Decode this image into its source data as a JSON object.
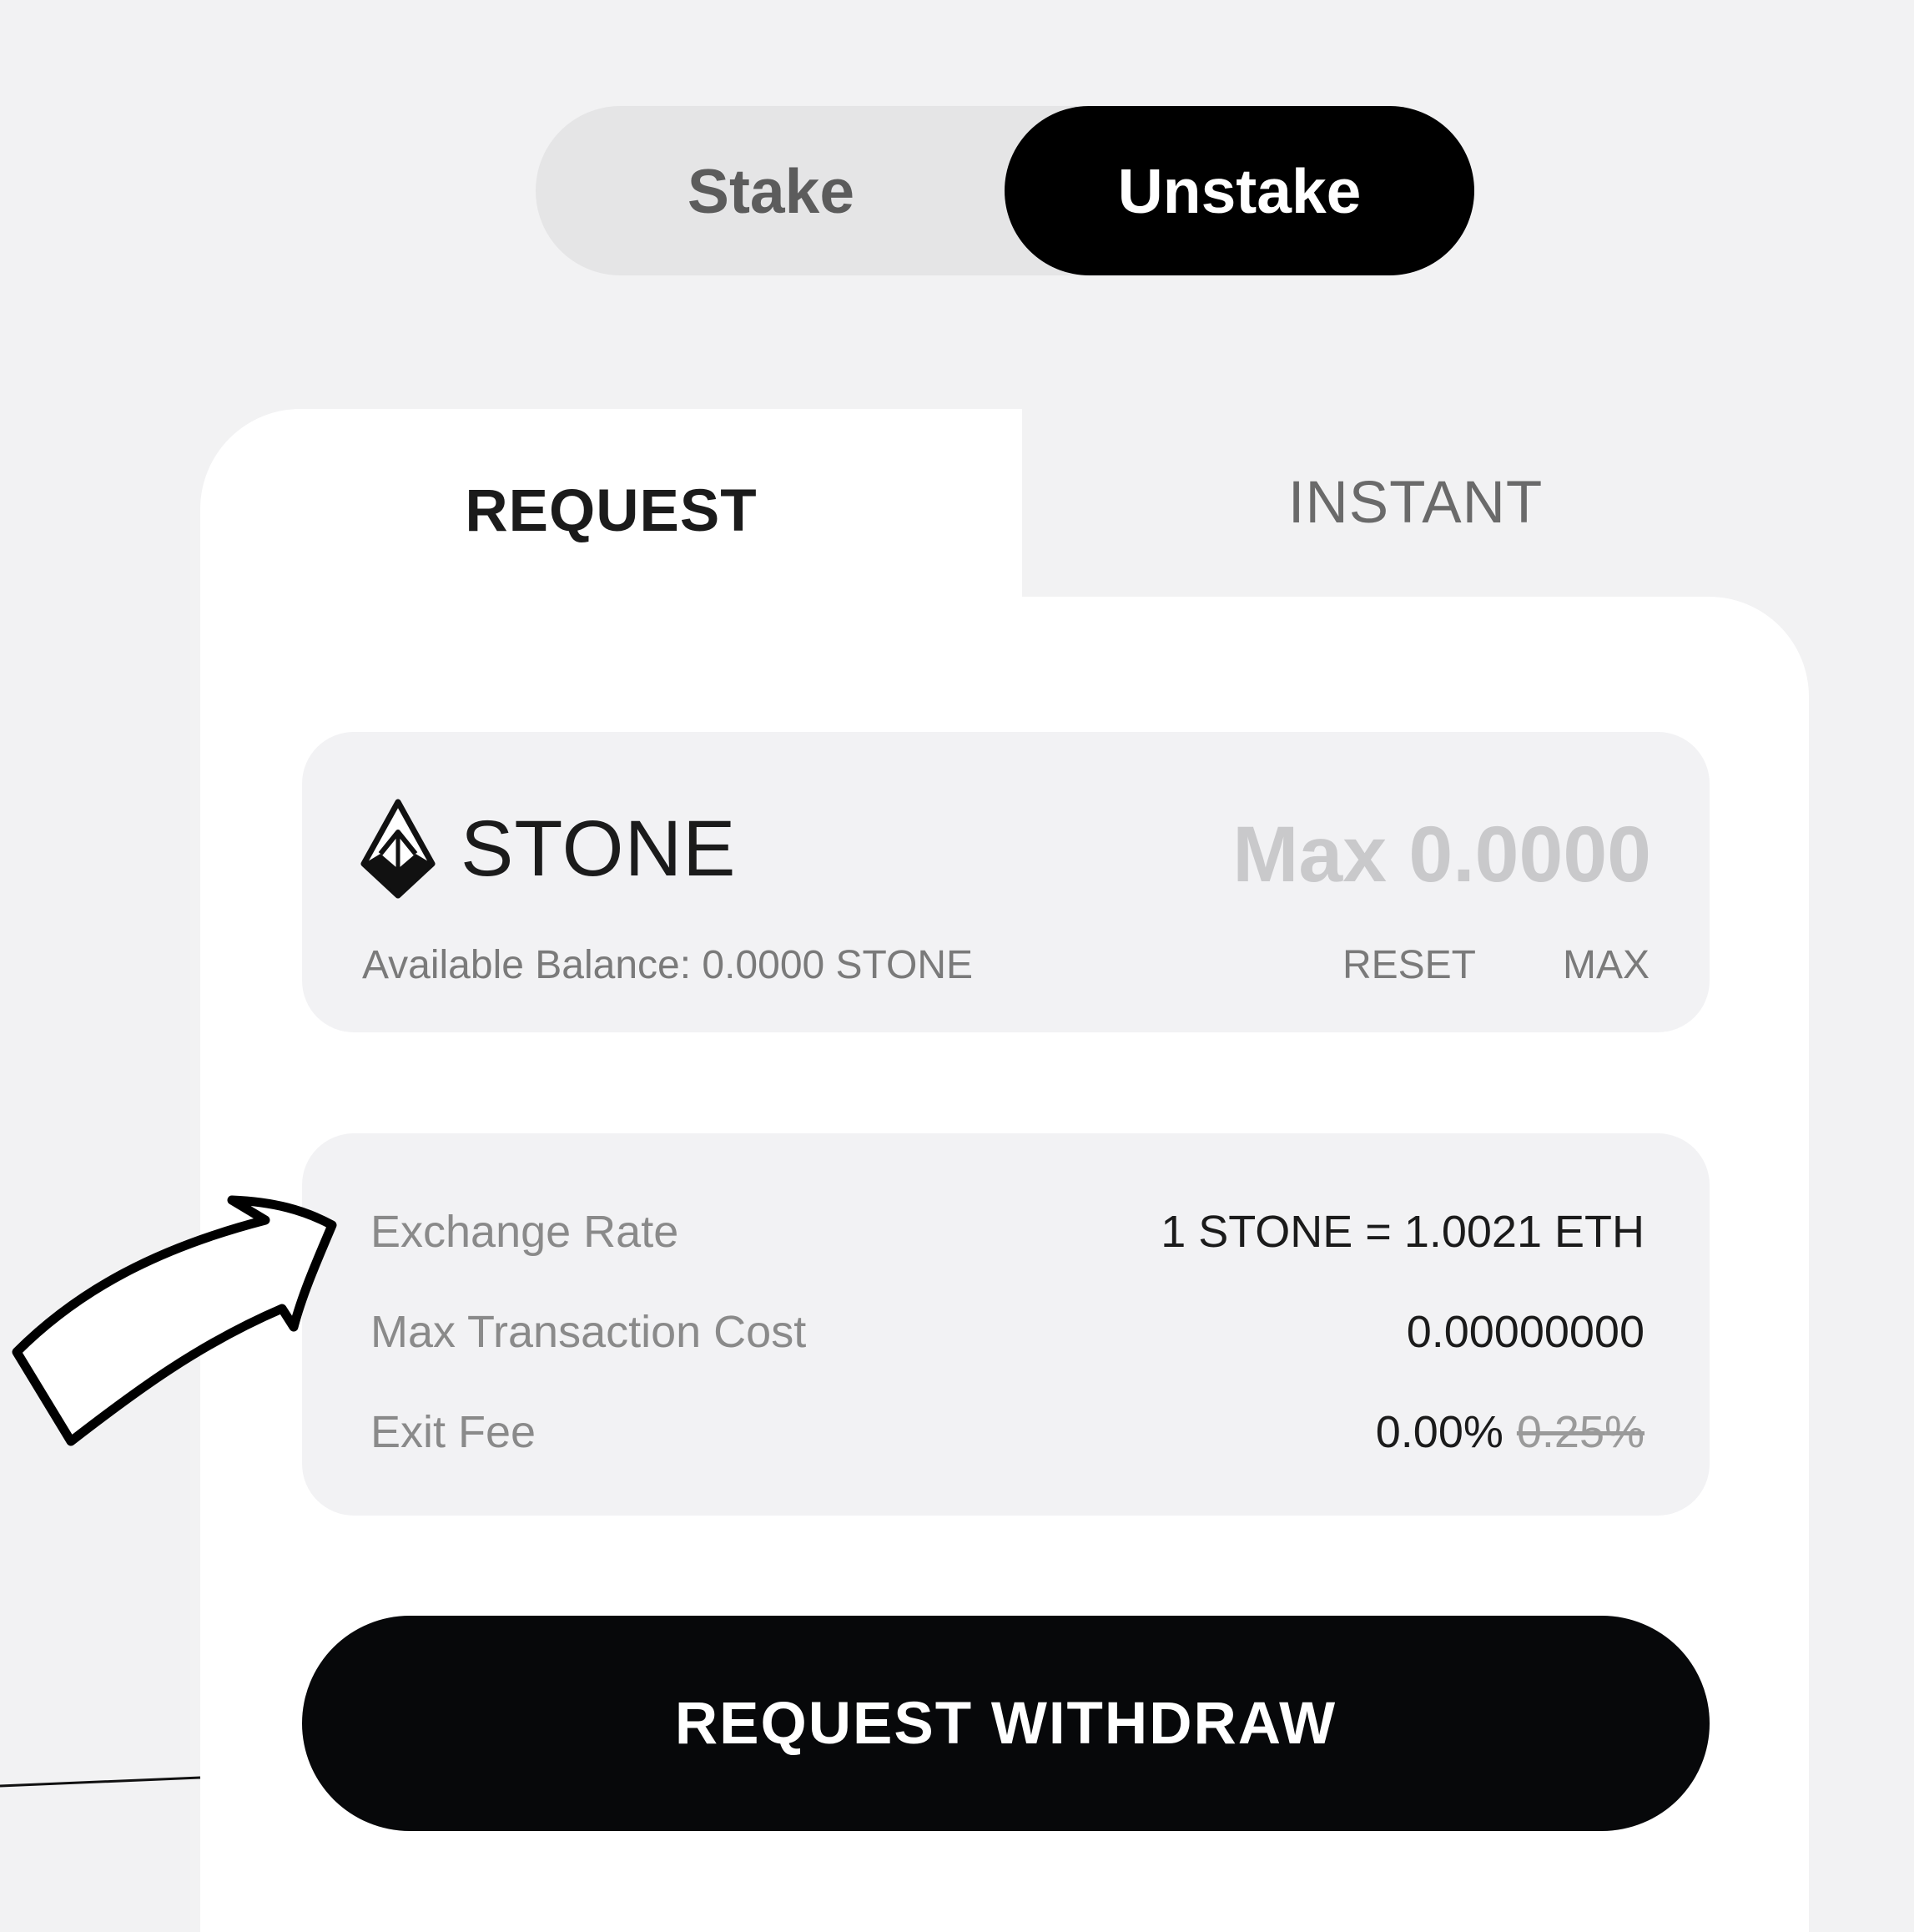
{
  "toggle": {
    "stake_label": "Stake",
    "unstake_label": "Unstake",
    "selected": "Unstake"
  },
  "tabs": {
    "request_label": "REQUEST",
    "instant_label": "INSTANT",
    "selected": "REQUEST"
  },
  "amount": {
    "token_icon": "stone-token-icon",
    "token_name": "STONE",
    "placeholder": "Max 0.0000",
    "balance_text": "Available Balance: 0.0000 STONE",
    "reset_label": "RESET",
    "max_label": "MAX"
  },
  "info": {
    "exchange_rate_label": "Exchange Rate",
    "exchange_rate_value": "1 STONE = 1.0021 ETH",
    "tx_cost_label": "Max Transaction Cost",
    "tx_cost_value": "0.00000000",
    "exit_fee_label": "Exit Fee",
    "exit_fee_value": "0.00%",
    "exit_fee_original": "0.25%"
  },
  "actions": {
    "withdraw_label": "REQUEST WITHDRAW"
  },
  "colors": {
    "background": "#f2f2f3",
    "accent": "#000000",
    "panel": "#f2f2f4"
  }
}
